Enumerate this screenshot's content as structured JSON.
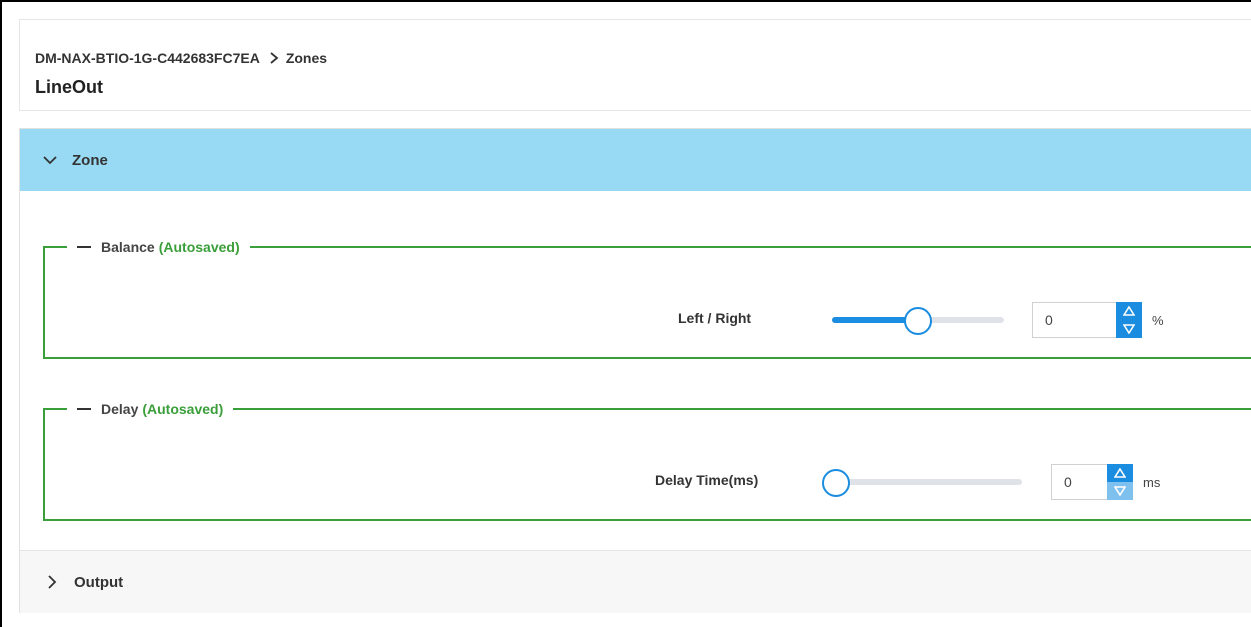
{
  "breadcrumb": {
    "device": "DM-NAX-BTIO-1G-C442683FC7EA",
    "section": "Zones"
  },
  "page_title": "LineOut",
  "zone_section": {
    "label": "Zone",
    "expanded": true
  },
  "balance": {
    "legend": "Balance",
    "status": "(Autosaved)",
    "row_label": "Left / Right",
    "slider_level": 0.5,
    "value": "0",
    "unit": "%"
  },
  "delay": {
    "legend": "Delay",
    "status": "(Autosaved)",
    "row_label": "Delay Time(ms)",
    "slider_level": 0,
    "value": "0",
    "unit": "ms"
  },
  "output_section": {
    "label": "Output",
    "expanded": false
  },
  "colors": {
    "accent": "#1a8de0",
    "section_header": "#98d9f3",
    "group_border": "#3a9e3a"
  },
  "icons": {
    "breadcrumb_separator": "chevron-right-icon",
    "zone_toggle": "chevron-down-icon",
    "output_toggle": "chevron-right-icon",
    "collapse_group": "minus-icon",
    "spin_up": "triangle-up-icon",
    "spin_down": "triangle-down-icon"
  }
}
